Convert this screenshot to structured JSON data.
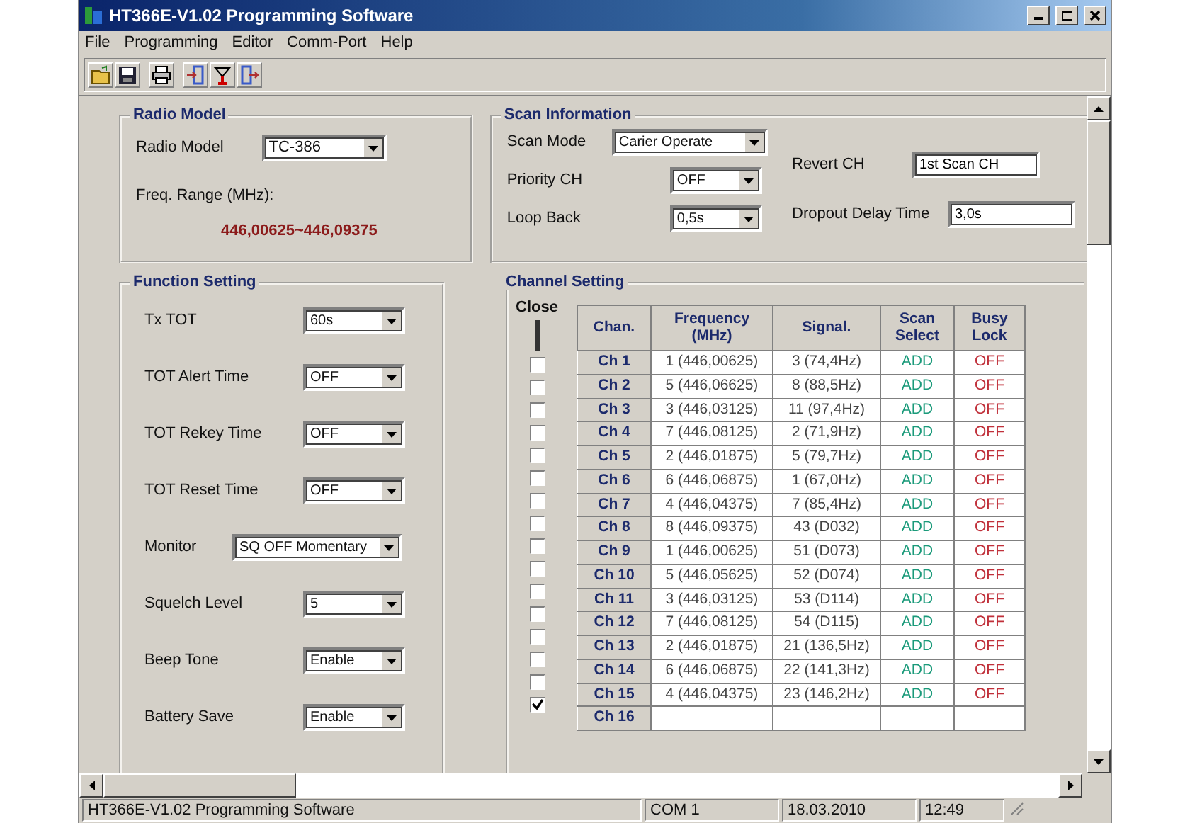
{
  "window": {
    "title": "HT366E-V1.02 Programming Software"
  },
  "menu": [
    "File",
    "Programming",
    "Editor",
    "Comm-Port",
    "Help"
  ],
  "radio_model": {
    "title": "Radio Model",
    "model_label": "Radio Model",
    "model_value": "TC-386",
    "range_label": "Freq. Range (MHz):",
    "range_value": "446,00625~446,09375"
  },
  "scan_information": {
    "title": "Scan Information",
    "fields": [
      {
        "label": "Scan Mode",
        "value": "Carier Operate",
        "kind": "combo"
      },
      {
        "label": "Priority CH",
        "value": "OFF",
        "kind": "combo"
      },
      {
        "label": "Loop Back",
        "value": "0,5s",
        "kind": "combo"
      },
      {
        "label": "Revert CH",
        "value": "1st Scan CH",
        "kind": "text"
      },
      {
        "label": "Dropout Delay Time",
        "value": "3,0s",
        "kind": "text"
      }
    ]
  },
  "function_setting": {
    "title": "Function Setting",
    "fields": [
      {
        "label": "Tx TOT",
        "value": "60s"
      },
      {
        "label": "TOT Alert Time",
        "value": "OFF"
      },
      {
        "label": "TOT Rekey Time",
        "value": "OFF"
      },
      {
        "label": "TOT Reset Time",
        "value": "OFF"
      },
      {
        "label": "Monitor",
        "value": "SQ OFF Momentary"
      },
      {
        "label": "Squelch Level",
        "value": "5"
      },
      {
        "label": "Beep Tone",
        "value": "Enable"
      },
      {
        "label": "Battery Save",
        "value": "Enable"
      }
    ]
  },
  "channel_setting": {
    "title": "Channel Setting",
    "close_label": "Close",
    "columns": [
      "Chan.",
      "Frequency (MHz)",
      "Signal.",
      "Scan Select",
      "Busy Lock"
    ],
    "rows": [
      {
        "chan": "Ch 1",
        "frequency": "1 (446,00625)",
        "signal": "3 (74,4Hz)",
        "scan_select": "ADD",
        "busy_lock": "OFF",
        "closed": false
      },
      {
        "chan": "Ch 2",
        "frequency": "5 (446,06625)",
        "signal": "8 (88,5Hz)",
        "scan_select": "ADD",
        "busy_lock": "OFF",
        "closed": false
      },
      {
        "chan": "Ch 3",
        "frequency": "3 (446,03125)",
        "signal": "11 (97,4Hz)",
        "scan_select": "ADD",
        "busy_lock": "OFF",
        "closed": false
      },
      {
        "chan": "Ch 4",
        "frequency": "7 (446,08125)",
        "signal": "2 (71,9Hz)",
        "scan_select": "ADD",
        "busy_lock": "OFF",
        "closed": false
      },
      {
        "chan": "Ch 5",
        "frequency": "2 (446,01875)",
        "signal": "5 (79,7Hz)",
        "scan_select": "ADD",
        "busy_lock": "OFF",
        "closed": false
      },
      {
        "chan": "Ch 6",
        "frequency": "6 (446,06875)",
        "signal": "1 (67,0Hz)",
        "scan_select": "ADD",
        "busy_lock": "OFF",
        "closed": false
      },
      {
        "chan": "Ch 7",
        "frequency": "4 (446,04375)",
        "signal": "7 (85,4Hz)",
        "scan_select": "ADD",
        "busy_lock": "OFF",
        "closed": false
      },
      {
        "chan": "Ch 8",
        "frequency": "8 (446,09375)",
        "signal": "43 (D032)",
        "scan_select": "ADD",
        "busy_lock": "OFF",
        "closed": false
      },
      {
        "chan": "Ch 9",
        "frequency": "1 (446,00625)",
        "signal": "51 (D073)",
        "scan_select": "ADD",
        "busy_lock": "OFF",
        "closed": false
      },
      {
        "chan": "Ch 10",
        "frequency": "5 (446,05625)",
        "signal": "52 (D074)",
        "scan_select": "ADD",
        "busy_lock": "OFF",
        "closed": false
      },
      {
        "chan": "Ch 11",
        "frequency": "3 (446,03125)",
        "signal": "53 (D114)",
        "scan_select": "ADD",
        "busy_lock": "OFF",
        "closed": false
      },
      {
        "chan": "Ch 12",
        "frequency": "7 (446,08125)",
        "signal": "54 (D115)",
        "scan_select": "ADD",
        "busy_lock": "OFF",
        "closed": false
      },
      {
        "chan": "Ch 13",
        "frequency": "2 (446,01875)",
        "signal": "21 (136,5Hz)",
        "scan_select": "ADD",
        "busy_lock": "OFF",
        "closed": false
      },
      {
        "chan": "Ch 14",
        "frequency": "6 (446,06875)",
        "signal": "22 (141,3Hz)",
        "scan_select": "ADD",
        "busy_lock": "OFF",
        "closed": false
      },
      {
        "chan": "Ch 15",
        "frequency": "4 (446,04375)",
        "signal": "23 (146,2Hz)",
        "scan_select": "ADD",
        "busy_lock": "OFF",
        "closed": false
      },
      {
        "chan": "Ch 16",
        "closed": true
      }
    ]
  },
  "status_bar": [
    "HT366E-V1.02 Programming Software",
    "COM 1",
    "18.03.2010",
    "12:49"
  ]
}
